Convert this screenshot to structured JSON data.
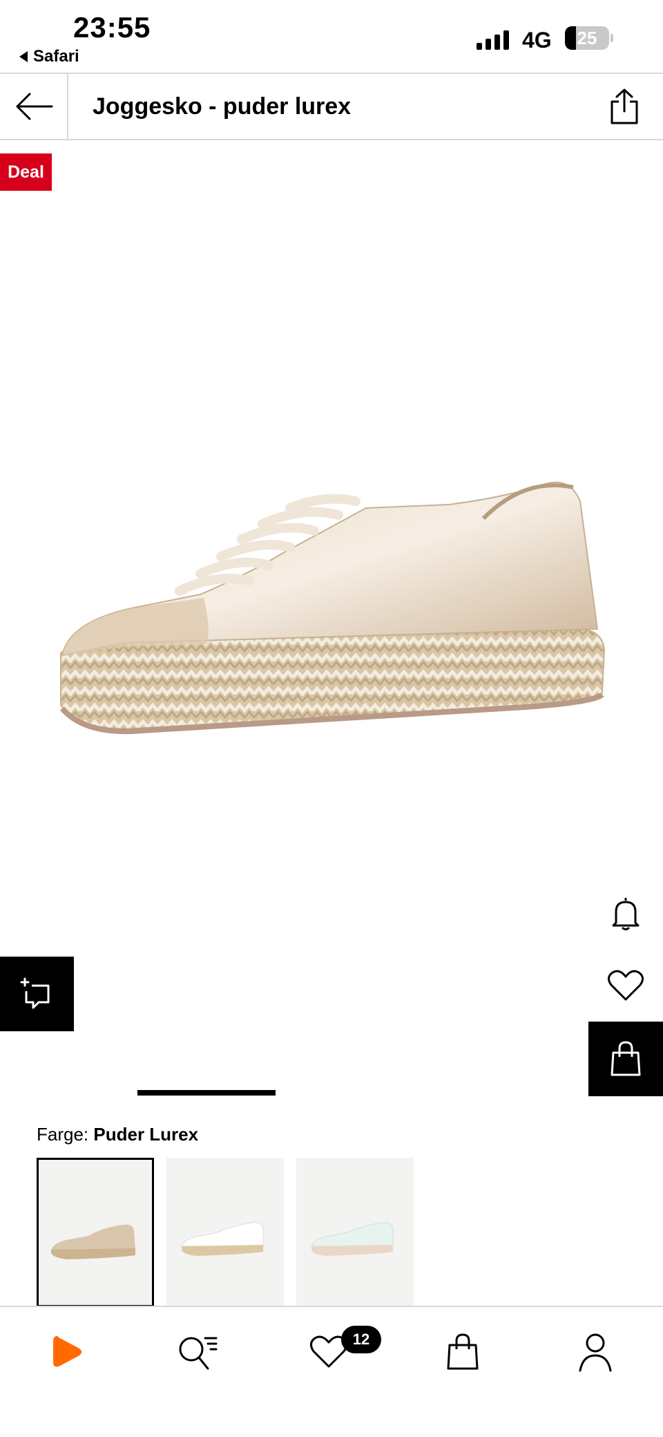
{
  "status_bar": {
    "time": "23:55",
    "back_app_label": "Safari",
    "network": "4G",
    "battery_level": "25",
    "battery_fraction": 0.25
  },
  "header": {
    "title": "Joggesko - puder lurex",
    "back_icon": "arrow-left-icon",
    "share_icon": "share-icon"
  },
  "product": {
    "deal_badge": "Deal",
    "image_icon": "sneaker-image",
    "actions": {
      "similar_icon": "similar-items-icon",
      "notify_icon": "bell-icon",
      "wishlist_icon": "heart-icon",
      "cart_icon": "shopping-bag-icon"
    }
  },
  "color": {
    "label": "Farge:",
    "value": "Puder Lurex",
    "swatches": [
      {
        "color": "#d6c2a8",
        "selected": true
      },
      {
        "color": "#f2f2f0",
        "selected": false
      },
      {
        "color": "#e4f0ec",
        "selected": false
      }
    ]
  },
  "bottom_nav": {
    "items": [
      "home-logo-icon",
      "search-icon",
      "wishlist-icon",
      "bag-icon",
      "profile-icon"
    ],
    "wishlist_count": "12"
  },
  "colors": {
    "deal_red": "#d6001c",
    "brand_orange": "#ff6900",
    "black": "#000000"
  }
}
